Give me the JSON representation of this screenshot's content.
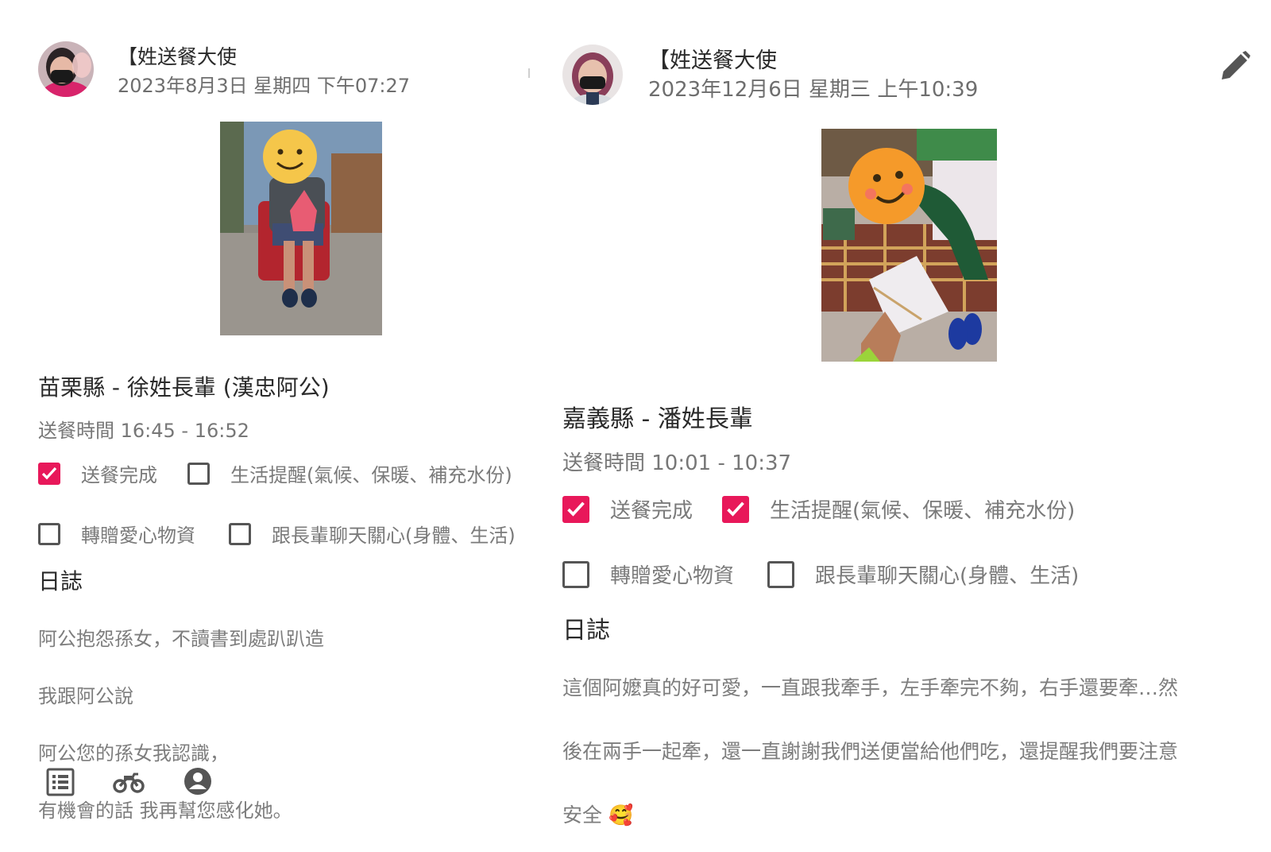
{
  "posts": [
    {
      "author": "【姓送餐大使",
      "timestamp": "2023年8月3日 星期四 下午07:27",
      "elder_title": "苗栗縣 - 徐姓長輩 (漢忠阿公)",
      "delivery_time": "送餐時間 16:45 - 16:52",
      "checks": [
        {
          "label": "送餐完成",
          "checked": true
        },
        {
          "label": "生活提醒(氣候、保暖、補充水份)",
          "checked": false
        },
        {
          "label": "轉贈愛心物資",
          "checked": false
        },
        {
          "label": "跟長輩聊天關心(身體、生活)",
          "checked": false
        }
      ],
      "log_title": "日誌",
      "log_lines": [
        "阿公抱怨孫女，不讀書到處趴趴造",
        "我跟阿公說",
        "阿公您的孫女我認識，",
        "有機會的話 我再幫您感化她。"
      ]
    },
    {
      "author": "【姓送餐大使",
      "timestamp": "2023年12月6日 星期三 上午10:39",
      "elder_title": "嘉義縣 - 潘姓長輩",
      "delivery_time": "送餐時間 10:01 - 10:37",
      "checks": [
        {
          "label": "送餐完成",
          "checked": true
        },
        {
          "label": "生活提醒(氣候、保暖、補充水份)",
          "checked": true
        },
        {
          "label": "轉贈愛心物資",
          "checked": false
        },
        {
          "label": "跟長輩聊天關心(身體、生活)",
          "checked": false
        }
      ],
      "log_title": "日誌",
      "log_lines": [
        "這個阿嬤真的好可愛，一直跟我牽手，左手牽完不夠，右手還要牽…然",
        "後在兩手一起牽，還一直謝謝我們送便當給他們吃，還提醒我們要注意",
        "安全 🥰"
      ]
    }
  ],
  "bottom_nav": [
    "list-icon",
    "motorcycle-icon",
    "account-icon"
  ],
  "colors": {
    "accent": "#e8185a"
  }
}
